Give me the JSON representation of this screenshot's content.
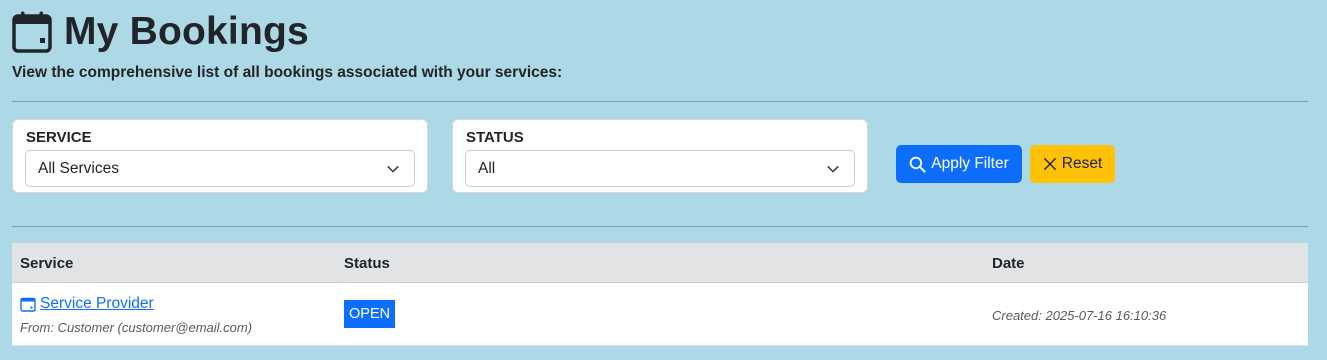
{
  "header": {
    "title": "My Bookings",
    "subtitle": "View the comprehensive list of all bookings associated with your services:",
    "icon": "calendar-icon"
  },
  "filters": {
    "service": {
      "label": "SERVICE",
      "selected": "All Services"
    },
    "status": {
      "label": "STATUS",
      "selected": "All"
    },
    "apply_label": "Apply Filter",
    "reset_label": "Reset"
  },
  "table": {
    "headers": [
      "Service",
      "Status",
      "Date"
    ],
    "rows": [
      {
        "service": "Service Provider",
        "from": "From: Customer (customer@email.com)",
        "status": "OPEN",
        "created": "Created: 2025-07-16 16:10:36"
      }
    ]
  },
  "colors": {
    "background": "#add8e6",
    "primary": "#0d6efd",
    "warning": "#ffc107",
    "table_header": "#e2e3e5"
  }
}
